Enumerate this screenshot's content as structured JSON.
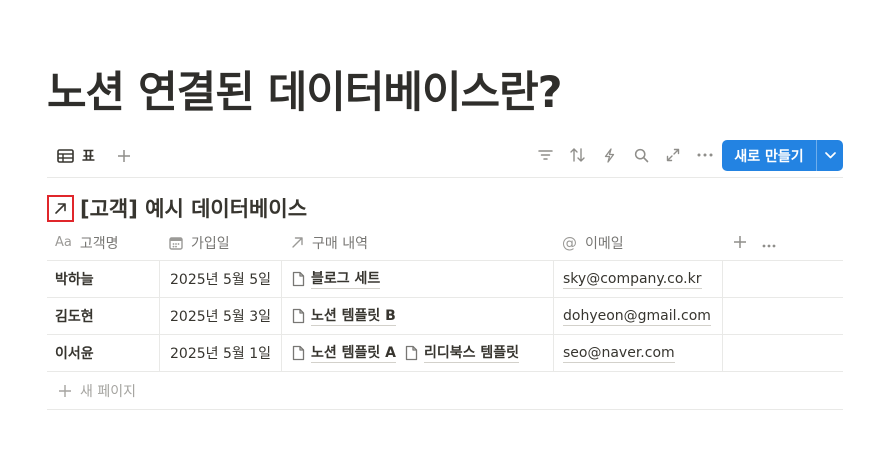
{
  "page": {
    "title": "노션 연결된 데이터베이스란?"
  },
  "toolbar": {
    "view_label": "표",
    "new_button_label": "새로 만들기",
    "icons": [
      "filter-icon",
      "sort-icon",
      "lightning-icon",
      "search-icon",
      "expand-icon",
      "more-icon"
    ]
  },
  "database": {
    "title": "[고객] 예시 데이터베이스",
    "columns": [
      {
        "label": "고객명",
        "icon": "Aa"
      },
      {
        "label": "가입일",
        "icon": "calendar-icon"
      },
      {
        "label": "구매 내역",
        "icon": "relation-arrow-icon"
      },
      {
        "label": "이메일",
        "icon": "@"
      }
    ],
    "rows": [
      {
        "name": "박하늘",
        "date": "2025년 5월 5일",
        "purchases": [
          "블로그 세트"
        ],
        "email": "sky@company.co.kr"
      },
      {
        "name": "김도현",
        "date": "2025년 5월 3일",
        "purchases": [
          "노션 템플릿 B"
        ],
        "email": "dohyeon@gmail.com"
      },
      {
        "name": "이서윤",
        "date": "2025년 5월 1일",
        "purchases": [
          "노션 템플릿 A",
          "리디북스 템플릿"
        ],
        "email": "seo@naver.com"
      }
    ],
    "new_page_label": "새 페이지"
  },
  "colors": {
    "accent": "#2383e2",
    "highlight_border": "#e0262b",
    "text": "#37352f",
    "muted": "#787774"
  }
}
